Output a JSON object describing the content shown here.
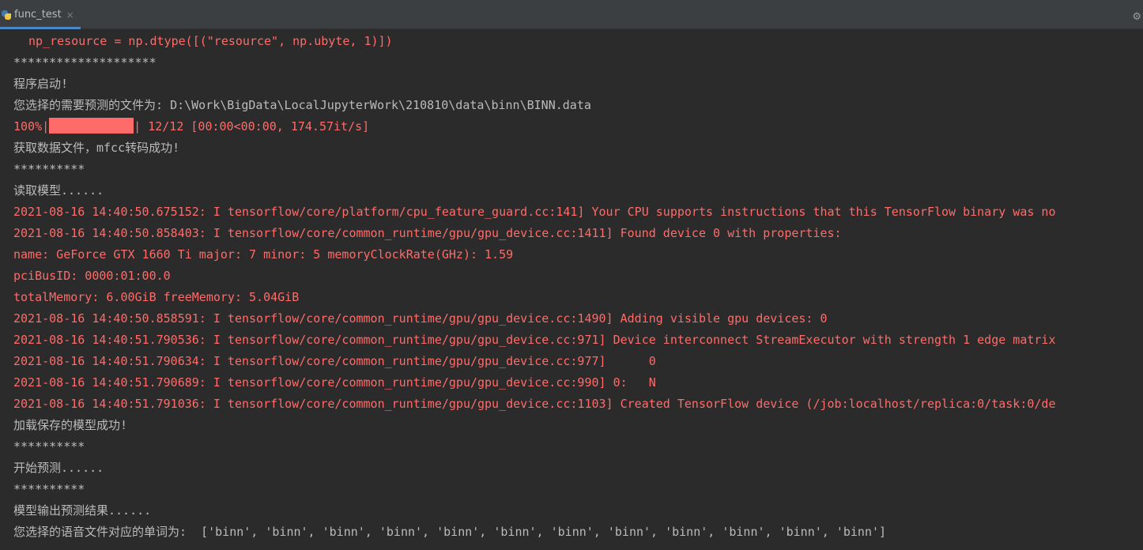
{
  "tab": {
    "title": "func_test",
    "close_glyph": "×",
    "icon": "python-file-icon"
  },
  "toolbar": {
    "settings_icon": "gear-icon",
    "settings_glyph": "⚙"
  },
  "colors": {
    "background": "#2b2b2b",
    "stderr": "#ff6b68",
    "stdout": "#bbbbbb",
    "tab_underline": "#4a88c7"
  },
  "console": {
    "lines": [
      "np_resource = np.dtype([(\"resource\", np.ubyte, 1)])",
      "********************",
      "程序启动!",
      "您选择的需要预测的文件为: D:\\Work\\BigData\\LocalJupyterWork\\210810\\data\\binn\\BINN.data",
      {
        "prefix": "100%|",
        "suffix": "| 12/12 [00:00<00:00, 174.57it/s]",
        "progress": 1.0
      },
      "获取数据文件，mfcc转码成功!",
      "**********",
      "读取模型......",
      "2021-08-16 14:40:50.675152: I tensorflow/core/platform/cpu_feature_guard.cc:141] Your CPU supports instructions that this TensorFlow binary was no",
      "2021-08-16 14:40:50.858403: I tensorflow/core/common_runtime/gpu/gpu_device.cc:1411] Found device 0 with properties:",
      "name: GeForce GTX 1660 Ti major: 7 minor: 5 memoryClockRate(GHz): 1.59",
      "pciBusID: 0000:01:00.0",
      "totalMemory: 6.00GiB freeMemory: 5.04GiB",
      "2021-08-16 14:40:50.858591: I tensorflow/core/common_runtime/gpu/gpu_device.cc:1490] Adding visible gpu devices: 0",
      "2021-08-16 14:40:51.790536: I tensorflow/core/common_runtime/gpu/gpu_device.cc:971] Device interconnect StreamExecutor with strength 1 edge matrix",
      "2021-08-16 14:40:51.790634: I tensorflow/core/common_runtime/gpu/gpu_device.cc:977]      0",
      "2021-08-16 14:40:51.790689: I tensorflow/core/common_runtime/gpu/gpu_device.cc:990] 0:   N",
      "2021-08-16 14:40:51.791036: I tensorflow/core/common_runtime/gpu/gpu_device.cc:1103] Created TensorFlow device (/job:localhost/replica:0/task:0/de",
      "加载保存的模型成功!",
      "**********",
      "开始预测......",
      "**********",
      "模型输出预测结果......",
      "您选择的语音文件对应的单词为:  ['binn', 'binn', 'binn', 'binn', 'binn', 'binn', 'binn', 'binn', 'binn', 'binn', 'binn', 'binn']"
    ]
  }
}
